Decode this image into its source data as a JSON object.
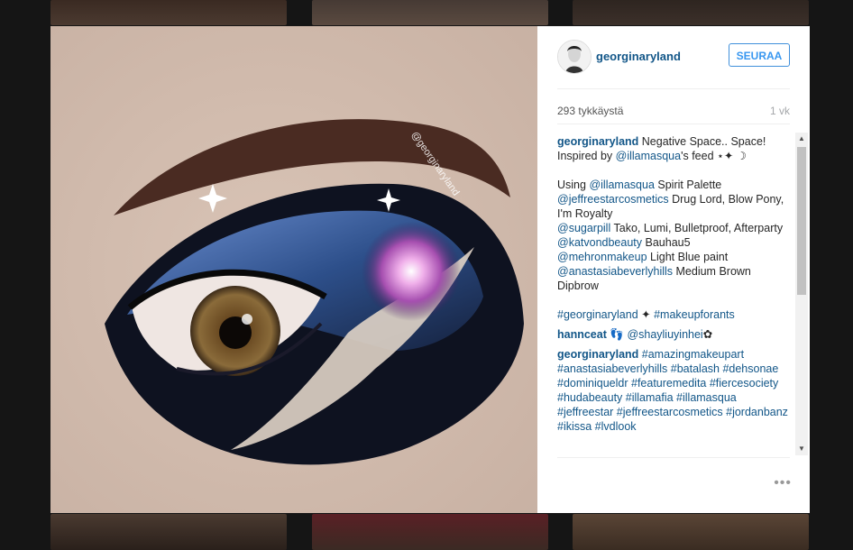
{
  "post": {
    "username": "georginaryland",
    "follow_label": "SEURAA",
    "likes": "293 tykkäystä",
    "time": "1 vk",
    "photo_watermark": "@georginaryland",
    "more_label": "•••"
  },
  "caption": {
    "user": "georginaryland",
    "line1": "Negative Space.. Space!",
    "line2_pre": "Inspired by",
    "line2_mention": "@illamasqua",
    "line2_post": "'s feed ⋆✦ ☽",
    "using_pre": "Using",
    "using_mention": "@illamasqua",
    "using_post": "Spirit Palette",
    "m1": "@jeffreestarcosmetics",
    "m1_text": "Drug Lord, Blow Pony, I'm Royalty",
    "m2": "@sugarpill",
    "m2_text": "Tako, Lumi, Bulletproof, Afterparty",
    "m3": "@katvondbeauty",
    "m3_text": "Bauhau5",
    "m4": "@mehronmakeup",
    "m4_text": "Light Blue paint",
    "m5": "@anastasiabeverlyhills",
    "m5_text": "Medium Brown Dipbrow",
    "hashtags_1": "#georginaryland",
    "hashtags_1_emoji": "✦",
    "hashtags_2": "#makeupforants"
  },
  "comments": [
    {
      "user": "hannceat",
      "emoji": "👣",
      "mention": "@shayliuyinhei",
      "emoji2": "✿"
    },
    {
      "user": "georginaryland",
      "tags": "#amazingmakeupart #anastasiabeverlyhills #batalash #dehsonae #dominiqueldr #featuremedita #fiercesociety #hudabeauty #illamafia #illamasqua #jeffreestar #jeffreestarcosmetics #jordanbanz #ikissa #lvdlook"
    }
  ],
  "scrollbar": {
    "up": "▲",
    "down": "▼"
  }
}
